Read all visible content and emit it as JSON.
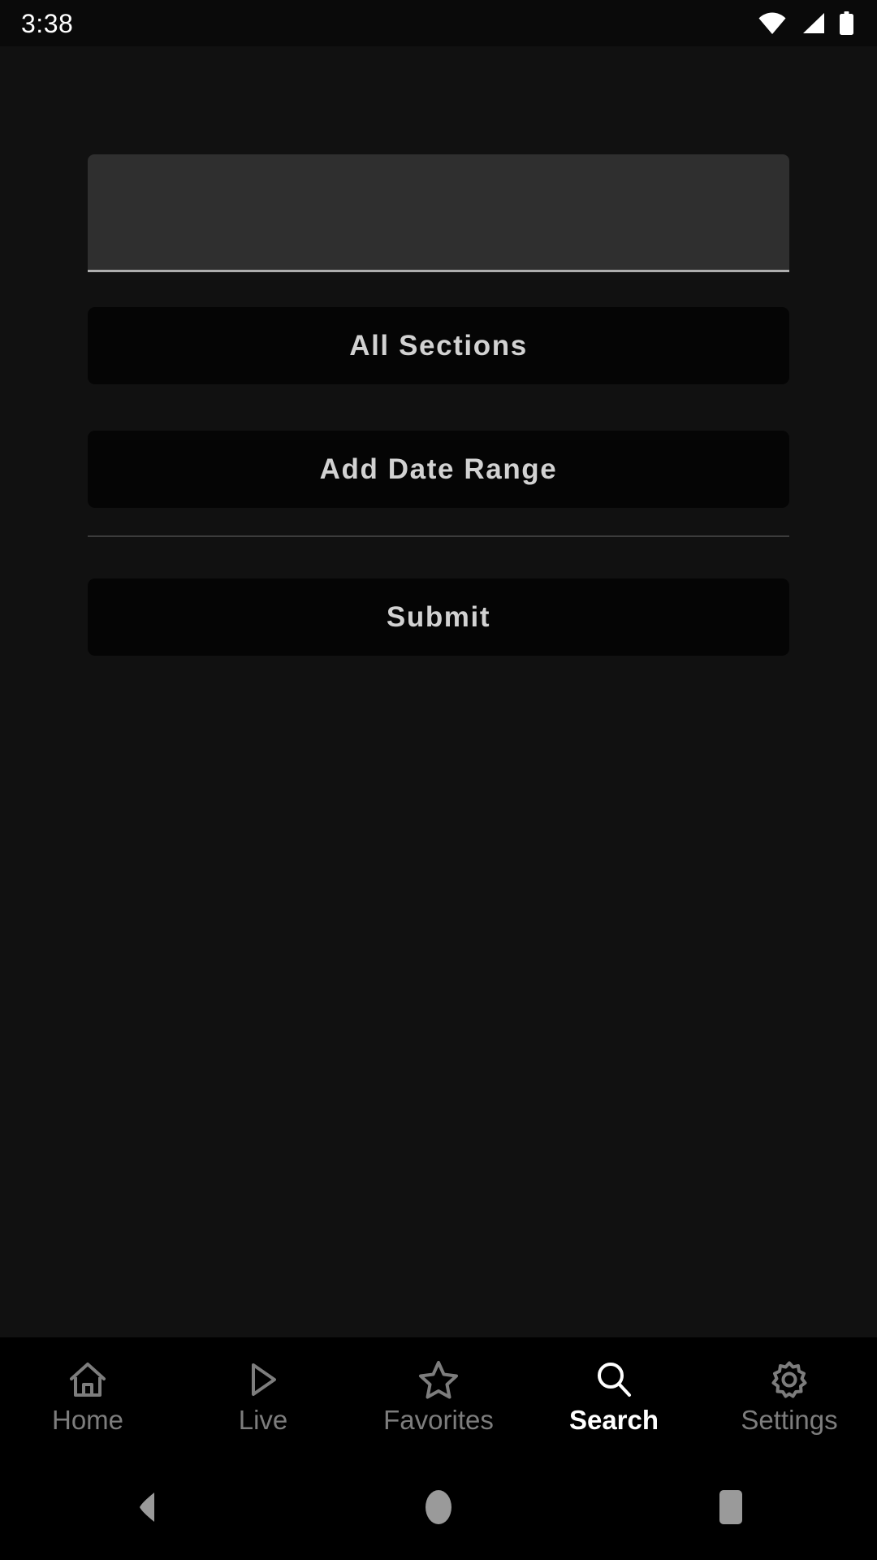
{
  "status_bar": {
    "time": "3:38",
    "icons": [
      "wifi-icon",
      "cellular-signal-icon",
      "battery-icon"
    ]
  },
  "screen": {
    "background_color": "#111111",
    "accent_color": "#ffffff"
  },
  "form": {
    "search_input": {
      "value": "",
      "placeholder": ""
    },
    "buttons": [
      {
        "label": "All Sections",
        "name": "all-sections-button"
      },
      {
        "label": "Add Date Range",
        "name": "add-date-range-button"
      },
      {
        "label": "Submit",
        "name": "submit-button"
      }
    ]
  },
  "tab_bar": {
    "active": "Search",
    "items": [
      {
        "label": "Home",
        "icon": "home-icon",
        "active": false
      },
      {
        "label": "Live",
        "icon": "play-icon",
        "active": false
      },
      {
        "label": "Favorites",
        "icon": "star-icon",
        "active": false
      },
      {
        "label": "Search",
        "icon": "search-icon",
        "active": true
      },
      {
        "label": "Settings",
        "icon": "gear-icon",
        "active": false
      }
    ]
  },
  "system_nav": {
    "buttons": [
      "back-icon",
      "home-circle-icon",
      "recents-square-icon"
    ]
  }
}
